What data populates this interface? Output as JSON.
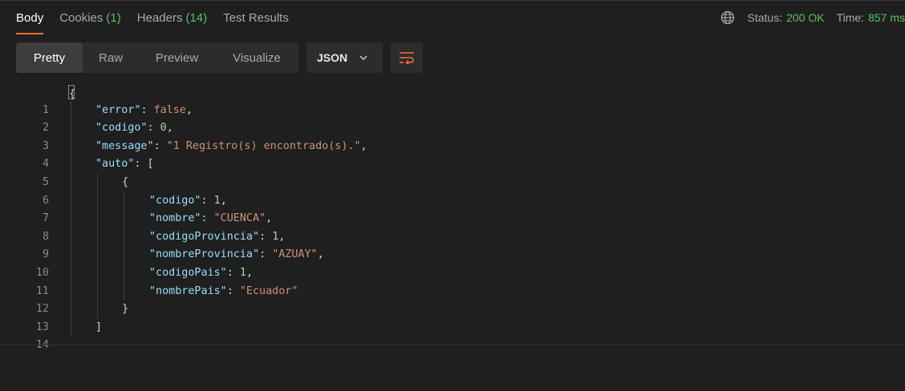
{
  "tabs": [
    {
      "label": "Body",
      "count": ""
    },
    {
      "label": "Cookies",
      "count": "(1)"
    },
    {
      "label": "Headers",
      "count": "(14)"
    },
    {
      "label": "Test Results",
      "count": ""
    }
  ],
  "status": {
    "label": "Status:",
    "value": "200 OK",
    "time_label": "Time:",
    "time_value": "857 ms"
  },
  "views": [
    "Pretty",
    "Raw",
    "Preview",
    "Visualize"
  ],
  "format": "JSON",
  "colors": {
    "accent": "#ff6c37",
    "success": "#5fbf63",
    "key": "#9cdcfe",
    "string": "#ce9178",
    "number": "#b5cea8"
  },
  "icons": {
    "globe": "globe-icon",
    "chevron": "chevron-down-icon",
    "wrap": "wrap-lines-icon"
  },
  "code": {
    "line_numbers": [
      "1",
      "2",
      "3",
      "4",
      "5",
      "6",
      "7",
      "8",
      "9",
      "10",
      "11",
      "12",
      "13",
      "14"
    ],
    "open_brace": "{",
    "error_key": "\"error\"",
    "error_val": "false",
    "codigo_key": "\"codigo\"",
    "codigo_val": "0",
    "message_key": "\"message\"",
    "message_val": "\"1 Registro(s) encontrado(s).\"",
    "auto_key": "\"auto\"",
    "auto_open": "[",
    "obj_open": "{",
    "i_codigo_key": "\"codigo\"",
    "i_codigo_val": "1",
    "i_nombre_key": "\"nombre\"",
    "i_nombre_val": "\"CUENCA\"",
    "i_codprov_key": "\"codigoProvincia\"",
    "i_codprov_val": "1",
    "i_nomprov_key": "\"nombreProvincia\"",
    "i_nomprov_val": "\"AZUAY\"",
    "i_codpais_key": "\"codigoPais\"",
    "i_codpais_val": "1",
    "i_nompais_key": "\"nombrePais\"",
    "i_nompais_val": "\"Ecuador\"",
    "obj_close": "}",
    "auto_close": "]"
  }
}
